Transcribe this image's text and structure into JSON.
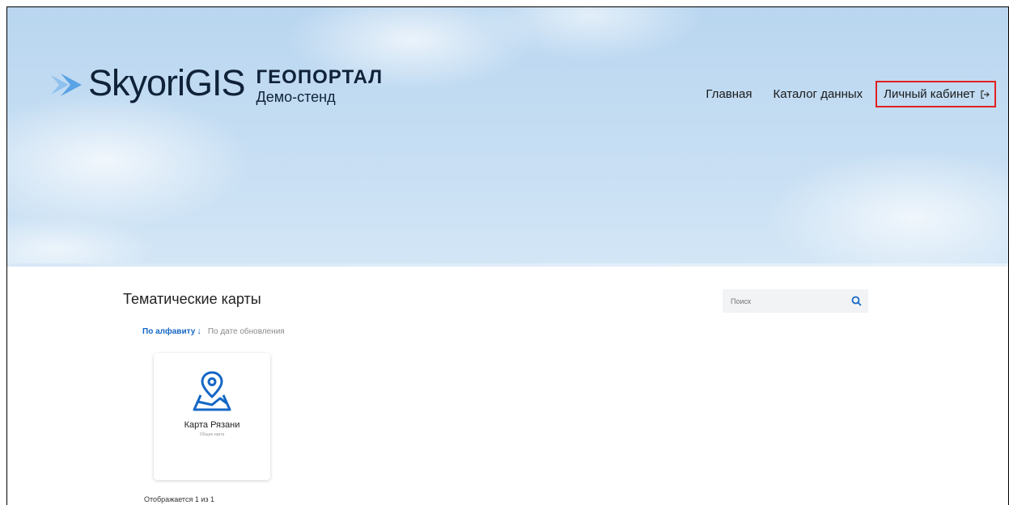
{
  "brand": {
    "name": "SkyoriGIS",
    "product": "ГЕОПОРТАЛ",
    "subtitle": "Демо-стенд",
    "logo_color": "#5aa3e6"
  },
  "nav": {
    "items": [
      {
        "label": "Главная"
      },
      {
        "label": "Каталог данных"
      },
      {
        "label": "Личный кабинет"
      }
    ],
    "highlight_color": "#e02020"
  },
  "section": {
    "title": "Тематические карты"
  },
  "search": {
    "placeholder": "Поиск",
    "icon": "search-icon"
  },
  "sort": {
    "active_label": "По алфавиту",
    "active_arrow": "↓",
    "other_label": "По дате обновления",
    "accent_color": "#1567c6"
  },
  "cards": [
    {
      "title": "Карта Рязани",
      "subtitle": "Общая карта",
      "icon": "map-pin-icon"
    }
  ],
  "footer": {
    "count_text": "Отображается 1 из 1"
  }
}
